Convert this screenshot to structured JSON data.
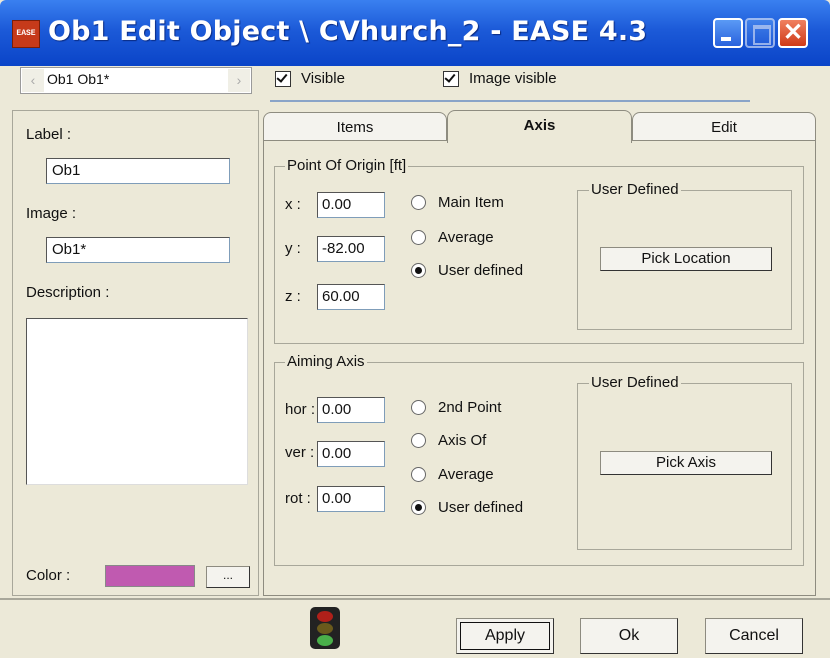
{
  "window": {
    "title": "Ob1 Edit Object \\ CVhurch_2 - EASE 4.3",
    "icon_label": "EASE",
    "close_glyph": "✕"
  },
  "top": {
    "object_nav": {
      "value": "Ob1 Ob1*",
      "prev_glyph": "‹",
      "next_glyph": "›"
    },
    "visible": {
      "label": "Visible",
      "checked": true
    },
    "image_visible": {
      "label": "Image visible",
      "checked": true
    }
  },
  "left": {
    "label_caption": "Label :",
    "label_value": "Ob1",
    "image_caption": "Image :",
    "image_value": "Ob1*",
    "description_caption": "Description :",
    "description_value": "",
    "color_caption": "Color :",
    "color_value": "#c05ab0",
    "color_button_label": "..."
  },
  "tabs": [
    {
      "label": "Items",
      "active": false
    },
    {
      "label": "Axis",
      "active": true
    },
    {
      "label": "Edit",
      "active": false
    }
  ],
  "origin": {
    "title": "Point Of Origin [ft]",
    "x_label": "x :",
    "x_value": "0.00",
    "y_label": "y :",
    "y_value": "-82.00",
    "z_label": "z :",
    "z_value": "60.00",
    "options": [
      {
        "label": "Main Item",
        "selected": false
      },
      {
        "label": "Average",
        "selected": false
      },
      {
        "label": "User defined",
        "selected": true
      }
    ],
    "user_defined_title": "User Defined",
    "pick_button": "Pick Location"
  },
  "aiming": {
    "title": "Aiming Axis",
    "hor_label": "hor :",
    "hor_value": "0.00",
    "ver_label": "ver :",
    "ver_value": "0.00",
    "rot_label": "rot :",
    "rot_value": "0.00",
    "options": [
      {
        "label": "2nd Point",
        "selected": false
      },
      {
        "label": "Axis Of",
        "selected": false
      },
      {
        "label": "Average",
        "selected": false
      },
      {
        "label": "User defined",
        "selected": true
      }
    ],
    "user_defined_title": "User Defined",
    "pick_button": "Pick Axis"
  },
  "footer": {
    "status_icon": "traffic-light-icon",
    "apply": "Apply",
    "ok": "Ok",
    "cancel": "Cancel"
  }
}
